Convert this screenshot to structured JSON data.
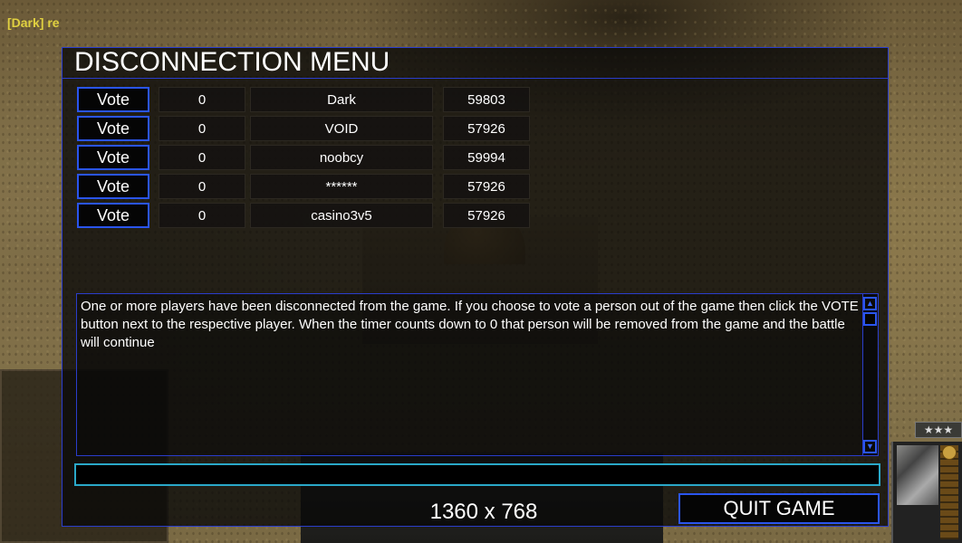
{
  "player_tag": "[Dark] re",
  "menu": {
    "title": "DISCONNECTION MENU",
    "vote_label": "Vote",
    "players": [
      {
        "votes": "0",
        "name": "Dark",
        "ping": "59803"
      },
      {
        "votes": "0",
        "name": "VOID",
        "ping": "57926"
      },
      {
        "votes": "0",
        "name": "noobcy",
        "ping": "59994"
      },
      {
        "votes": "0",
        "name": "******",
        "ping": "57926"
      },
      {
        "votes": "0",
        "name": "casino3v5",
        "ping": "57926"
      }
    ],
    "message": "One or more players have been disconnected from the game. If you choose to vote a person out of the game then click the VOTE button next to the respective player. When the timer counts down to 0 that person will be removed from the game and the battle will continue",
    "chat_value": "",
    "resolution": "1360 x 768",
    "quit_label": "QUIT GAME"
  },
  "hud": {
    "stars": "★★★"
  },
  "colors": {
    "accent_border": "#2a55ee",
    "chat_border": "#2aa8c8",
    "player_tag": "#e0d040"
  }
}
